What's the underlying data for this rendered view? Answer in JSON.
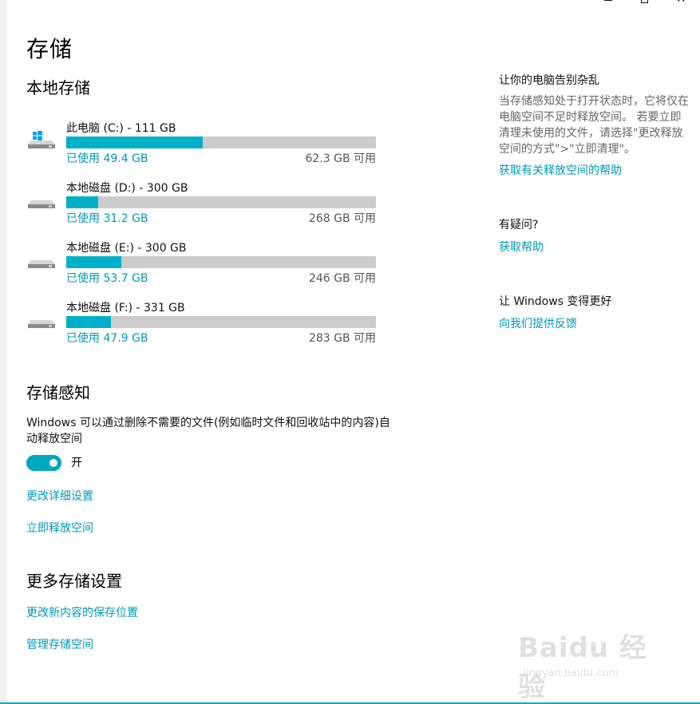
{
  "page": {
    "title": "存储"
  },
  "local_storage": {
    "heading": "本地存储",
    "drives": [
      {
        "name": "此电脑 (C:) - 111 GB",
        "used": "已使用 49.4 GB",
        "free": "62.3 GB 可用",
        "used_fraction": 0.442,
        "icon": "windows-drive-icon"
      },
      {
        "name": "本地磁盘 (D:) - 300 GB",
        "used": "已使用 31.2 GB",
        "free": "268 GB 可用",
        "used_fraction": 0.104,
        "icon": "hard-drive-icon"
      },
      {
        "name": "本地磁盘 (E:) - 300 GB",
        "used": "已使用 53.7 GB",
        "free": "246 GB 可用",
        "used_fraction": 0.179,
        "icon": "hard-drive-icon"
      },
      {
        "name": "本地磁盘 (F:) - 331 GB",
        "used": "已使用 47.9 GB",
        "free": "283 GB 可用",
        "used_fraction": 0.145,
        "icon": "hard-drive-icon"
      }
    ]
  },
  "storage_sense": {
    "heading": "存储感知",
    "description": "Windows 可以通过删除不需要的文件(例如临时文件和回收站中的内容)自动释放空间",
    "toggle_label": "开",
    "toggle_on": true,
    "links": [
      "更改详细设置",
      "立即释放空间"
    ]
  },
  "more_settings": {
    "heading": "更多存储设置",
    "links": [
      "更改新内容的保存位置",
      "管理存储空间"
    ]
  },
  "sidebar": {
    "declutter_title": "让你的电脑告别杂乱",
    "declutter_text": "当存储感知处于打开状态时，它将仅在电脑空间不足时释放空间。 若要立即清理未使用的文件，请选择\"更改释放空间的方式\">\"立即清理\"。",
    "declutter_link": "获取有关释放空间的帮助",
    "question_title": "有疑问?",
    "question_link": "获取帮助",
    "feedback_title": "让 Windows 变得更好",
    "feedback_link": "向我们提供反馈"
  },
  "watermark": {
    "logo": "Baidu 经验",
    "sub": "jingyan.baidu.com"
  },
  "colors": {
    "accent": "#00b0c8",
    "link": "#0099b8",
    "bar_bg": "#cccccc"
  }
}
